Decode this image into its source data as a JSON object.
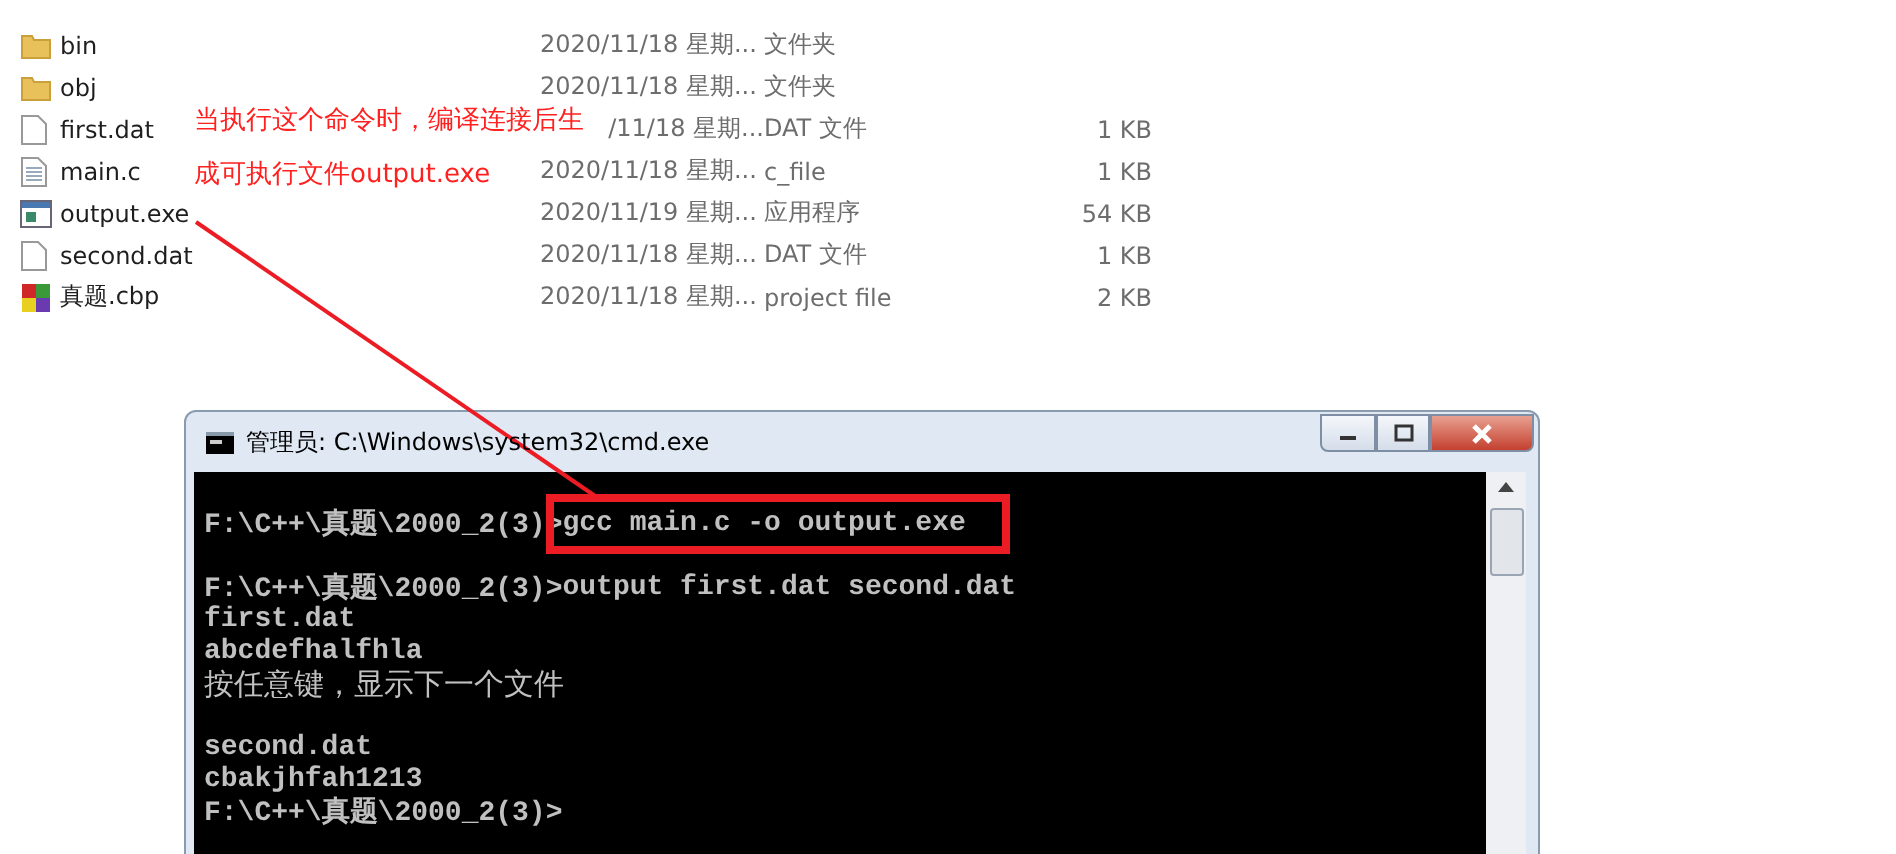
{
  "files": [
    {
      "kind": "folder",
      "name": "bin",
      "date": "2020/11/18 星期...",
      "date_covered": false,
      "type": "文件夹"
    },
    {
      "kind": "folder",
      "name": "obj",
      "date": "2020/11/18 星期...",
      "date_covered": false,
      "type": "文件夹"
    },
    {
      "kind": "file",
      "name": "first.dat",
      "date": "/11/18 星期...",
      "date_covered": true,
      "type": "DAT 文件",
      "size": "1 KB"
    },
    {
      "kind": "text",
      "name": "main.c",
      "date": "2020/11/18 星期...",
      "date_covered": false,
      "type": "c_file",
      "size": "1 KB"
    },
    {
      "kind": "exe",
      "name": "output.exe",
      "date": "2020/11/19 星期...",
      "date_covered": false,
      "type": "应用程序",
      "size": "54 KB"
    },
    {
      "kind": "file",
      "name": "second.dat",
      "date": "2020/11/18 星期...",
      "date_covered": false,
      "type": "DAT 文件",
      "size": "1 KB"
    },
    {
      "kind": "project",
      "name": "真题.cbp",
      "date": "2020/11/18 星期...",
      "date_covered": false,
      "type": "project file",
      "size": "2 KB"
    }
  ],
  "annotation": {
    "lines": [
      "当执行这个命令时，编译连接后生",
      "成可执行文件output.exe"
    ]
  },
  "console": {
    "title": "管理员: C:\\Windows\\system32\\cmd.exe",
    "lines": [
      {
        "kind": "command",
        "prompt": "F:\\C++\\真题\\2000_2(3)>",
        "command": "gcc main.c -o output.exe",
        "highlighted": true
      },
      {
        "kind": "blank"
      },
      {
        "kind": "command",
        "prompt": "F:\\C++\\真题\\2000_2(3)>",
        "command": "output first.dat second.dat",
        "highlighted": false
      },
      {
        "kind": "output",
        "text": "first.dat"
      },
      {
        "kind": "output",
        "text": "abcdefhalfhla"
      },
      {
        "kind": "message",
        "text": "按任意键，显示下一个文件"
      },
      {
        "kind": "blank"
      },
      {
        "kind": "output",
        "text": "second.dat"
      },
      {
        "kind": "output",
        "text": "cbakjhfah1213"
      },
      {
        "kind": "output",
        "text": "F:\\C++\\真题\\2000_2(3)>"
      }
    ]
  }
}
